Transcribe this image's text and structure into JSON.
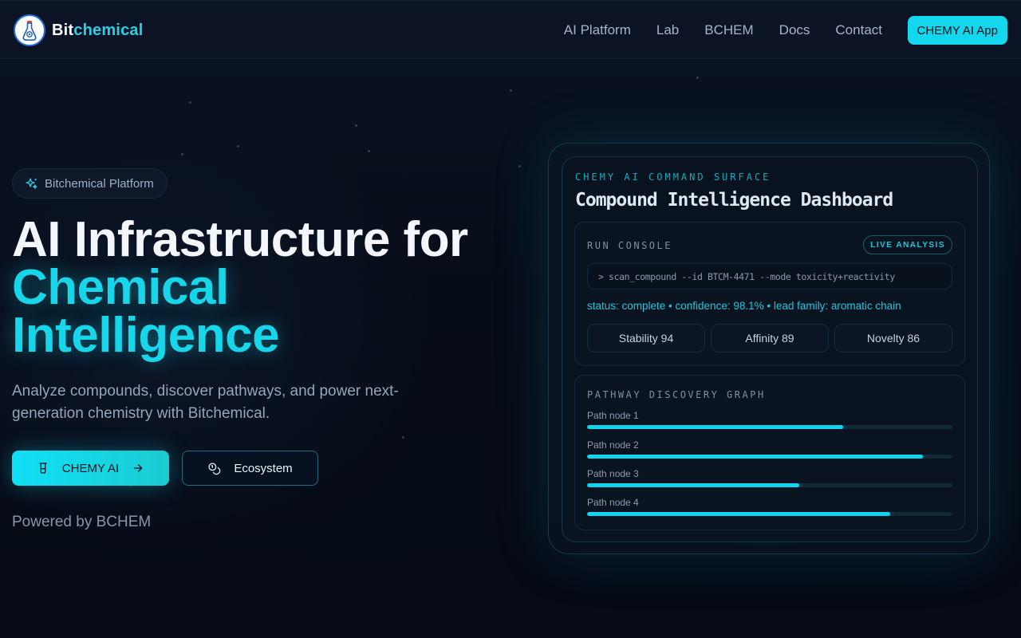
{
  "nav": {
    "brand_part1": "Bit",
    "brand_part2": "chemical",
    "links": [
      "AI Platform",
      "Lab",
      "BCHEM",
      "Docs",
      "Contact"
    ],
    "cta": "CHEMY AI App"
  },
  "hero": {
    "badge": "Bitchemical Platform",
    "title_line1": "AI Infrastructure for",
    "title_line2": "Chemical",
    "title_line3": "Intelligence",
    "subtitle": "Analyze compounds, discover pathways, and power next-generation chemistry with Bitchemical.",
    "primary_button": "CHEMY AI",
    "secondary_button": "Ecosystem",
    "powered_by": "Powered by BCHEM"
  },
  "dashboard": {
    "eyebrow": "CHEMY AI COMMAND SURFACE",
    "title": "Compound Intelligence Dashboard",
    "console": {
      "label": "RUN CONSOLE",
      "live_badge": "LIVE ANALYSIS",
      "command": "> scan_compound --id BTCM-4471 --mode toxicity+reactivity",
      "status": "status: complete • confidence: 98.1% • lead family: aromatic chain",
      "metrics": [
        "Stability 94",
        "Affinity 89",
        "Novelty 86"
      ]
    },
    "graph": {
      "label": "PATHWAY DISCOVERY GRAPH",
      "paths": [
        {
          "label": "Path node 1",
          "progress": 0.7
        },
        {
          "label": "Path node 2",
          "progress": 0.92
        },
        {
          "label": "Path node 3",
          "progress": 0.58
        },
        {
          "label": "Path node 4",
          "progress": 0.83
        }
      ]
    }
  },
  "colors": {
    "accent": "#14d6ec",
    "background": "#070d18",
    "nav_bg": "#0b1324"
  },
  "icons": {
    "logo": "flask-logo-icon",
    "badge": "sparkles-icon",
    "primary_button": "beaker-icon",
    "primary_arrow": "arrow-right-icon",
    "secondary_button": "coins-icon"
  }
}
